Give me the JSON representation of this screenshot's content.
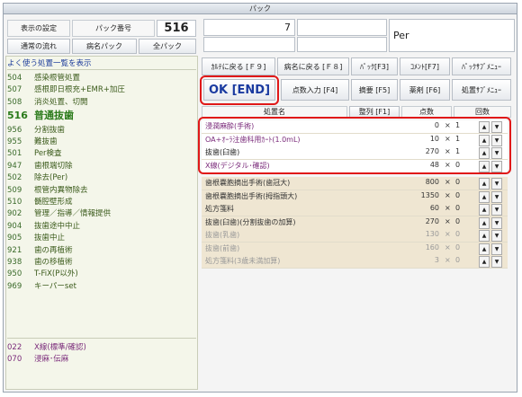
{
  "window": {
    "title": "パック"
  },
  "header": {
    "display_settings": "表示の設定",
    "pack_number_label": "パック番号",
    "pack_number": "516",
    "normal_flow": "通常の流れ",
    "disease_pack": "病名パック",
    "all_pack": "全パック",
    "field_value": "7",
    "per_label": "Per"
  },
  "left": {
    "section_title": "よく使う処置一覧を表示",
    "items": [
      {
        "code": "504",
        "name": "感染根管処置"
      },
      {
        "code": "507",
        "name": "感根即日根充+EMR+加圧"
      },
      {
        "code": "508",
        "name": "消炎処置、切開"
      },
      {
        "code": "516",
        "name": "普通抜歯"
      },
      {
        "code": "956",
        "name": "分割抜歯"
      },
      {
        "code": "955",
        "name": "難抜歯"
      },
      {
        "code": "501",
        "name": "Per検査"
      },
      {
        "code": "947",
        "name": "歯根端切除"
      },
      {
        "code": "502",
        "name": "除去(Per)"
      },
      {
        "code": "509",
        "name": "根管内異物除去"
      },
      {
        "code": "510",
        "name": "髄腔壁形成"
      },
      {
        "code": "902",
        "name": "管理／指導／情報提供"
      },
      {
        "code": "904",
        "name": "抜歯途中中止"
      },
      {
        "code": "905",
        "name": "抜歯中止"
      },
      {
        "code": "921",
        "name": "歯の再植術"
      },
      {
        "code": "938",
        "name": "歯の移植術"
      },
      {
        "code": "950",
        "name": "T-FiX(P以外)"
      },
      {
        "code": "969",
        "name": "キーパーset"
      }
    ],
    "bottom_items": [
      {
        "code": "022",
        "name": "X線(標準/確認)"
      },
      {
        "code": "070",
        "name": "浸麻･伝麻"
      }
    ]
  },
  "toolbar": {
    "back_to_chart": "ｶﾙﾃに戻る [Ｆ９]",
    "back_to_disease": "病名に戻る [Ｆ８]",
    "pack_f3": "ﾊﾟｯｸ[F3]",
    "comment_f7": "ｺﾒﾝﾄ[F7]",
    "pack_submenu": "ﾊﾟｯｸｻﾌﾞﾒﾆｭｰ",
    "ok_end": "OK [END]",
    "points_input": "点数入力 [F4]",
    "summary_f5": "摘要 [F5]",
    "drug_f6": "薬剤 [F6]",
    "procedure_submenu": "処置ｻﾌﾞﾒﾆｭｰ"
  },
  "table": {
    "headers": {
      "name": "処置名",
      "sort": "整列 [F1]",
      "points": "点数",
      "count": "回数"
    },
    "selected_rows": [
      {
        "name": "浸潤麻酔(手術)",
        "price": "0",
        "qty": "1"
      },
      {
        "name": "OA+ｵｰﾗ注歯科用ｶｰﾄ(1.0mL)",
        "price": "10",
        "qty": "1"
      },
      {
        "name": "抜歯(臼歯)",
        "price": "270",
        "qty": "1"
      },
      {
        "name": "X線(デジタル･確認)",
        "price": "48",
        "qty": "0"
      }
    ],
    "other_rows": [
      {
        "name": "歯根嚢胞摘出手術(歯冠大)",
        "price": "800",
        "qty": "0"
      },
      {
        "name": "歯根嚢胞摘出手術(拇指頭大)",
        "price": "1350",
        "qty": "0"
      },
      {
        "name": "処方箋料",
        "price": "60",
        "qty": "0"
      },
      {
        "name": "抜歯(臼歯)(分割抜歯の加算)",
        "price": "270",
        "qty": "0"
      },
      {
        "name": "抜歯(乳歯)",
        "price": "130",
        "qty": "0"
      },
      {
        "name": "抜歯(前歯)",
        "price": "160",
        "qty": "0"
      },
      {
        "name": "処方箋料(3歳未満加算)",
        "price": "3",
        "qty": "0"
      }
    ],
    "times": "×",
    "up_arrow": "▲",
    "down_arrow": "▼"
  },
  "colors": {
    "accent_red": "#e01818",
    "ok_blue": "#1a3aa0",
    "link_purple": "#7a2a7a"
  }
}
